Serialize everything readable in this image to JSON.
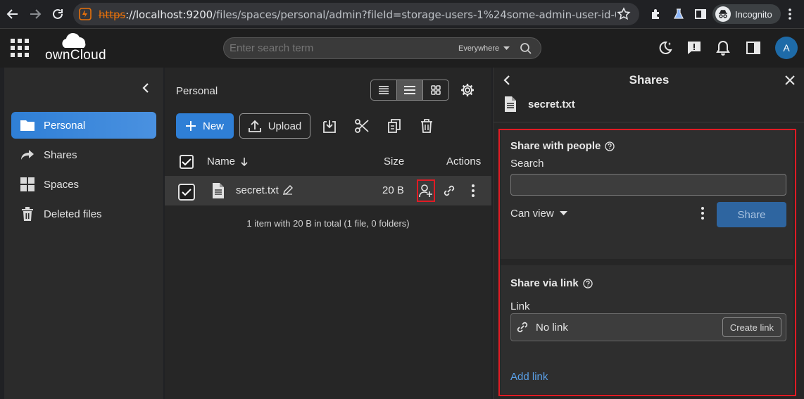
{
  "browser": {
    "url_scheme": "https",
    "url_host": "://localhost:9200",
    "url_rest": "/files/spaces/personal/admin?fileId=storage-users-1%24some-admin-user-id-0000-00...",
    "incognito_label": "Incognito"
  },
  "header": {
    "logo_text": "ownCloud",
    "search_placeholder": "Enter search term",
    "search_scope": "Everywhere",
    "avatar_initial": "A"
  },
  "sidebar": {
    "items": [
      {
        "label": "Personal",
        "icon": "folder-icon",
        "active": true
      },
      {
        "label": "Shares",
        "icon": "share-icon",
        "active": false
      },
      {
        "label": "Spaces",
        "icon": "spaces-grid-icon",
        "active": false
      },
      {
        "label": "Deleted files",
        "icon": "trash-icon",
        "active": false
      }
    ]
  },
  "main": {
    "breadcrumb": "Personal",
    "new_label": "New",
    "upload_label": "Upload",
    "columns": {
      "name": "Name",
      "size": "Size",
      "actions": "Actions"
    },
    "file": {
      "name": "secret.txt",
      "size": "20 B"
    },
    "footer": "1 item with 20 B in total (1 file, 0 folders)"
  },
  "panel": {
    "title": "Shares",
    "file_name": "secret.txt",
    "share_people": {
      "title": "Share with people",
      "search_label": "Search",
      "role": "Can view",
      "share_button": "Share"
    },
    "share_link": {
      "title": "Share via link",
      "link_label": "Link",
      "no_link": "No link",
      "create_button": "Create link",
      "add_link": "Add link"
    }
  },
  "colors": {
    "accent": "#2f7fd6",
    "highlight": "#e01b24"
  }
}
